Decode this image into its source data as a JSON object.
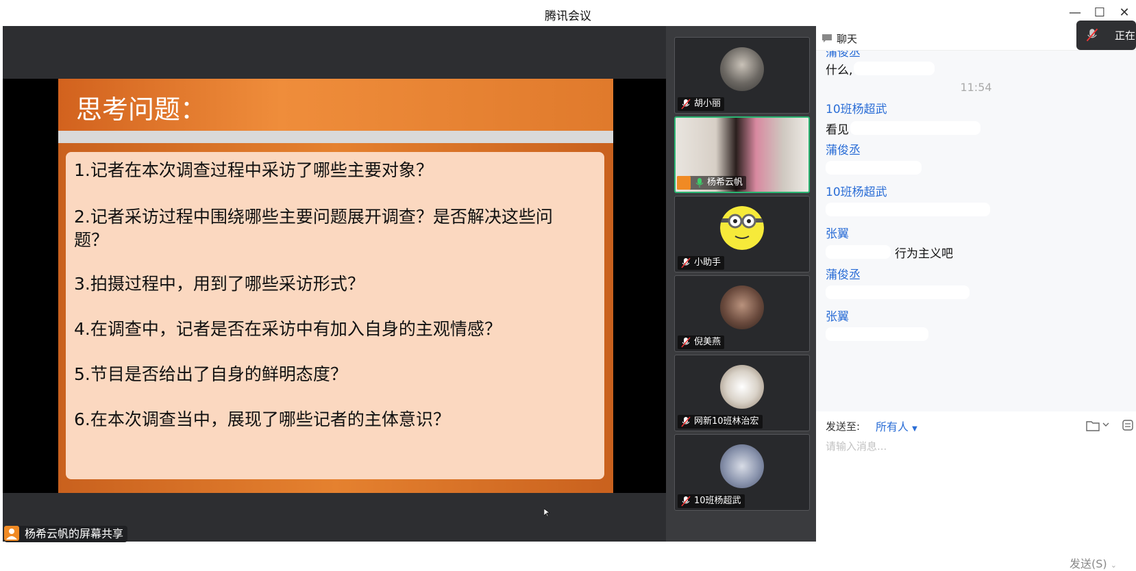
{
  "window": {
    "title": "腾讯会议",
    "minimize": "—",
    "maximize": "☐",
    "close": "✕"
  },
  "share": {
    "label": "杨希云帆的屏幕共享",
    "slide": {
      "title": "思考问题：",
      "questions": [
        "1.记者在本次调查过程中采访了哪些主要对象？",
        "2.记者采访过程中围绕哪些主要问题展开调查？是否解决这些问题？",
        "3.拍摄过程中，用到了哪些采访形式？",
        "4.在调查中，记者是否在采访中有加入自身的主观情感？",
        "5.节目是否给出了自身的鲜明态度？",
        "6.在本次调查当中，展现了哪些记者的主体意识？"
      ]
    }
  },
  "participants": [
    {
      "name": "胡小丽",
      "mic": "muted"
    },
    {
      "name": "杨希云帆",
      "mic": "on",
      "active": true
    },
    {
      "name": "小助手",
      "mic": "muted"
    },
    {
      "name": "倪美燕",
      "mic": "muted"
    },
    {
      "name": "网新10班林治宏",
      "mic": "muted"
    },
    {
      "name": "10班杨超武",
      "mic": "muted"
    }
  ],
  "chat": {
    "title": "聊天",
    "messages": [
      {
        "type": "name",
        "text": "蒲俊丞"
      },
      {
        "type": "text",
        "text": "什么,"
      },
      {
        "type": "time",
        "text": "11:54"
      },
      {
        "type": "name",
        "text": "10班杨超武"
      },
      {
        "type": "text",
        "text": "看见"
      },
      {
        "type": "name",
        "text": "蒲俊丞"
      },
      {
        "type": "name",
        "text": "10班杨超武"
      },
      {
        "type": "name",
        "text": "张翼"
      },
      {
        "type": "text",
        "text": "行为主义吧"
      },
      {
        "type": "name",
        "text": "蒲俊丞"
      },
      {
        "type": "name",
        "text": "张翼"
      }
    ],
    "send_to_label": "发送至:",
    "recipient": "所有人",
    "input_placeholder": "请输入消息...",
    "send_button": "发送(S)"
  },
  "toast": {
    "text": "正在"
  },
  "colors": {
    "accent": "#2a6dd6",
    "active_border": "#2bb673",
    "slide_orange": "#e5812f"
  }
}
